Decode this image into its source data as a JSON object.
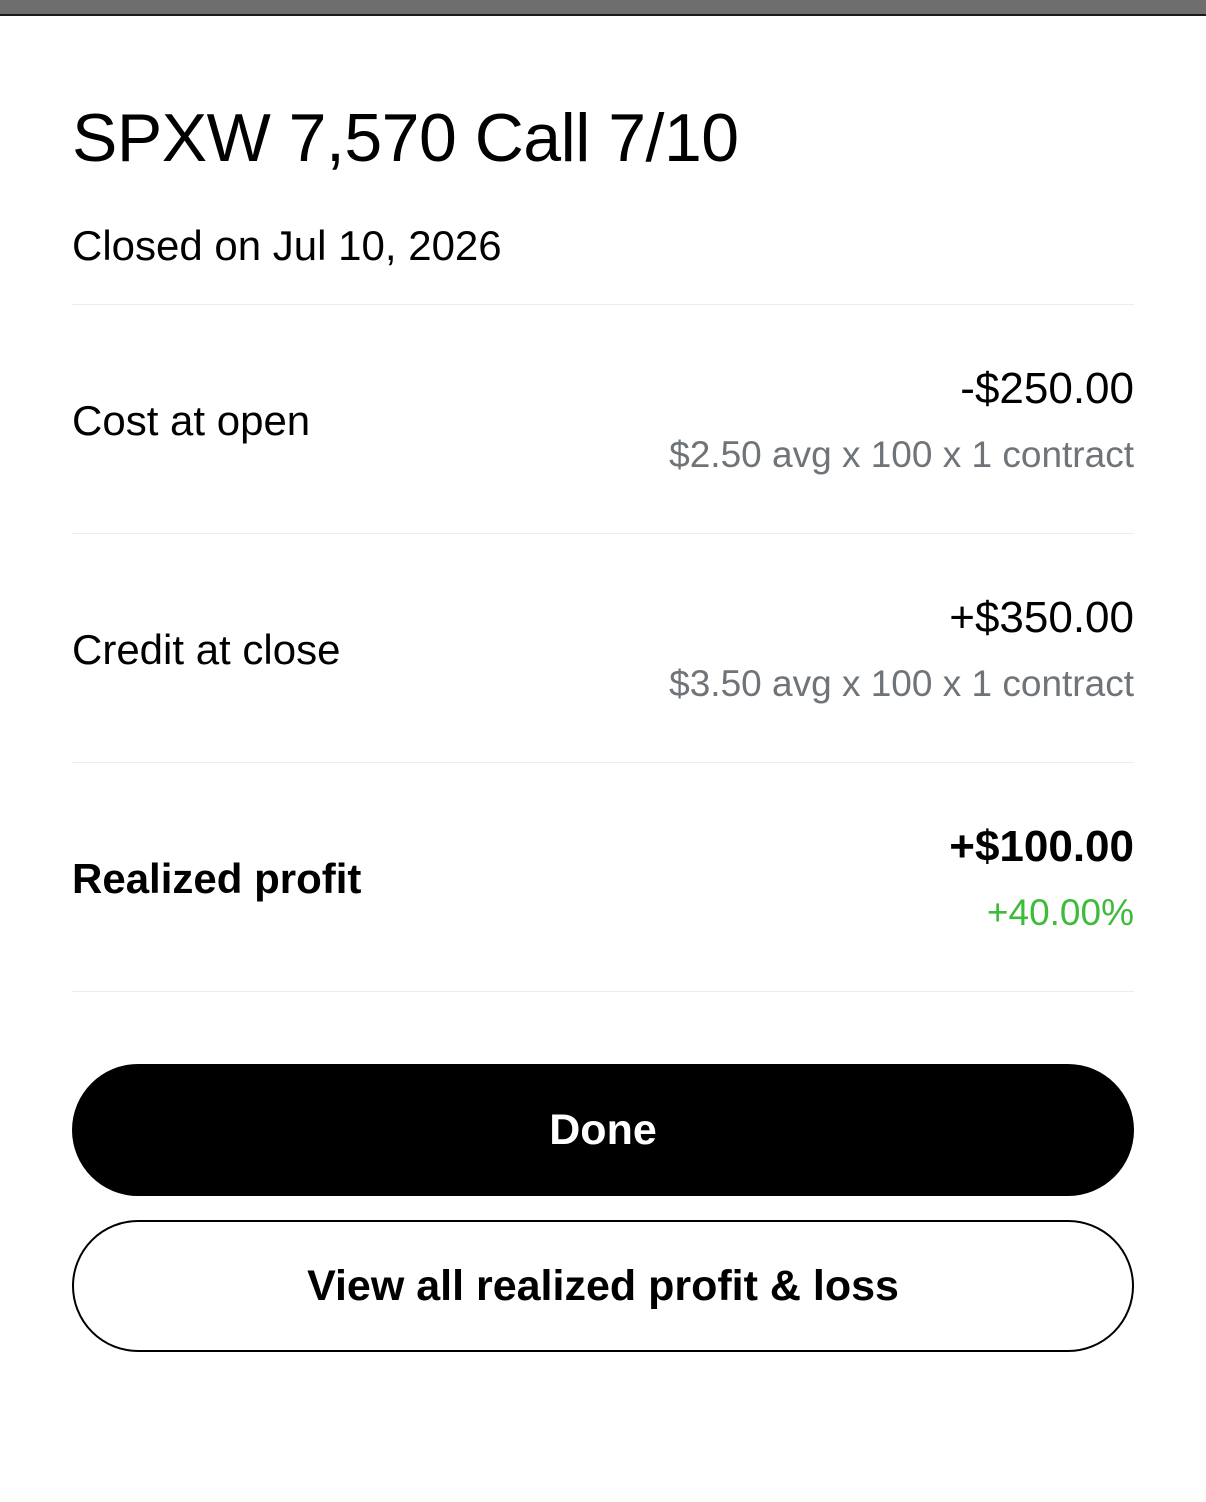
{
  "header": {
    "title": "SPXW 7,570 Call 7/10",
    "subtitle": "Closed on Jul 10, 2026"
  },
  "rows": [
    {
      "label": "Cost at open",
      "value": "-$250.00",
      "detail": "$2.50 avg x 100 x 1 contract"
    },
    {
      "label": "Credit at close",
      "value": "+$350.00",
      "detail": "$3.50 avg x 100 x 1 contract"
    },
    {
      "label": "Realized profit",
      "value": "+$100.00",
      "detail": "+40.00%"
    }
  ],
  "actions": {
    "done_label": "Done",
    "view_all_label": "View all realized profit & loss"
  },
  "colors": {
    "positive": "#3dbb3a",
    "muted": "#6f7479",
    "primary_button": "#000000"
  }
}
